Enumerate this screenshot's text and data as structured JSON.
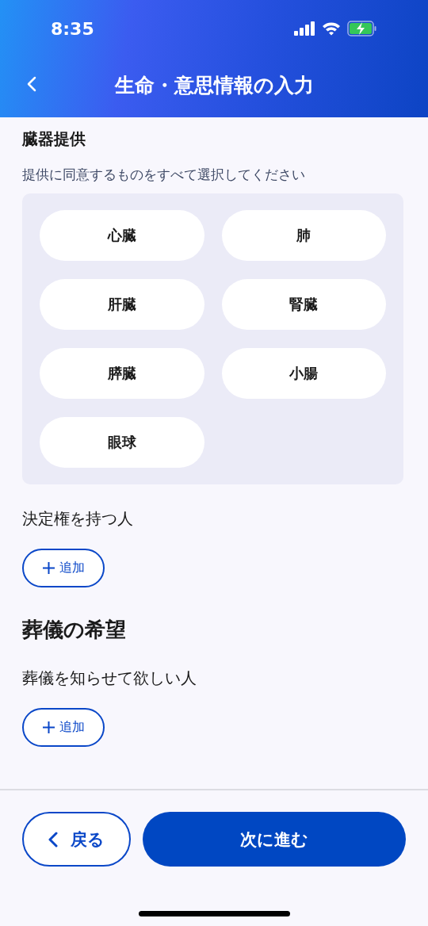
{
  "status_bar": {
    "time": "8:35"
  },
  "header": {
    "title": "生命・意思情報の入力"
  },
  "organ_donation": {
    "title": "臓器提供",
    "instruction": "提供に同意するものをすべて選択してください",
    "options": [
      {
        "label": "心臓",
        "selected": false
      },
      {
        "label": "肺",
        "selected": false
      },
      {
        "label": "肝臓",
        "selected": false
      },
      {
        "label": "腎臓",
        "selected": false
      },
      {
        "label": "膵臓",
        "selected": false
      },
      {
        "label": "小腸",
        "selected": false
      },
      {
        "label": "眼球",
        "selected": false
      }
    ]
  },
  "decision_maker": {
    "label": "決定権を持つ人",
    "add_button": "追加"
  },
  "funeral": {
    "title": "葬儀の希望",
    "notify_label": "葬儀を知らせて欲しい人",
    "add_button": "追加"
  },
  "footer": {
    "back_button": "戻る",
    "next_button": "次に進む"
  }
}
